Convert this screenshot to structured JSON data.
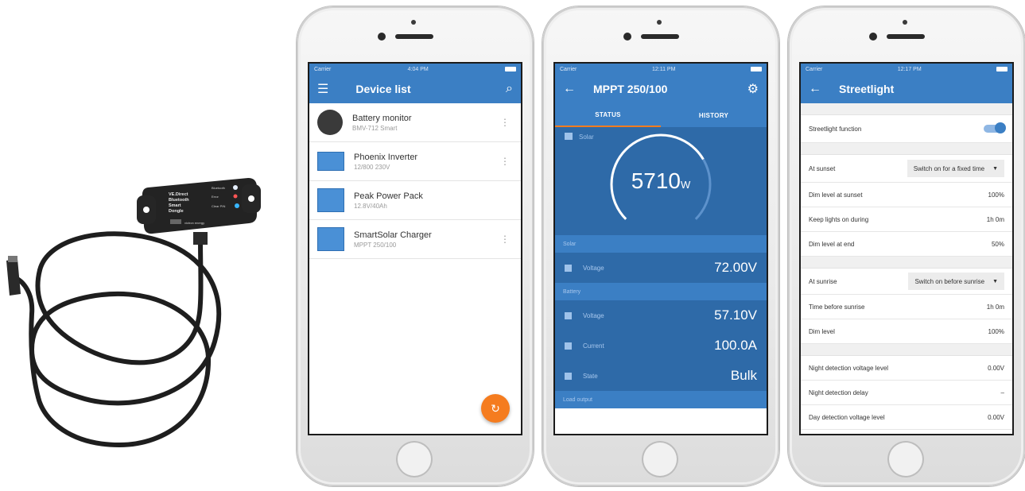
{
  "dongle": {
    "label_lines": [
      "VE.Direct",
      "Bluetooth",
      "Smart",
      "Dongle"
    ],
    "led_labels": [
      "Bluetooth",
      "Error",
      "Clear PIN"
    ],
    "brand": "victron energy"
  },
  "phone1": {
    "status": {
      "carrier": "Carrier",
      "time": "4:04 PM"
    },
    "appbar": {
      "title": "Device list",
      "menu_icon": "menu-icon",
      "search_icon": "search-icon"
    },
    "devices": [
      {
        "name": "Battery monitor",
        "sub": "BMV-712 Smart"
      },
      {
        "name": "Phoenix Inverter",
        "sub": "12/800 230V"
      },
      {
        "name": "Peak Power Pack",
        "sub": "12.8V/40Ah"
      },
      {
        "name": "SmartSolar Charger",
        "sub": "MPPT 250/100"
      }
    ],
    "fab_icon": "refresh-icon"
  },
  "phone2": {
    "status": {
      "carrier": "Carrier",
      "time": "12:11 PM"
    },
    "appbar": {
      "title": "MPPT 250/100",
      "back_icon": "back-arrow-icon",
      "settings_icon": "gear-icon"
    },
    "tabs": [
      "STATUS",
      "HISTORY"
    ],
    "solar": {
      "label": "Solar",
      "power_value": "5710",
      "power_unit": "W",
      "gauge_fraction": 0.72
    },
    "sections": [
      {
        "header": "Solar",
        "rows": [
          {
            "label": "Voltage",
            "value": "72.00V"
          }
        ]
      },
      {
        "header": "Battery",
        "rows": [
          {
            "label": "Voltage",
            "value": "57.10V"
          },
          {
            "label": "Current",
            "value": "100.0A"
          },
          {
            "label": "State",
            "value": "Bulk"
          }
        ]
      },
      {
        "header": "Load output",
        "rows": []
      }
    ]
  },
  "phone3": {
    "status": {
      "carrier": "Carrier",
      "time": "12:17 PM"
    },
    "appbar": {
      "title": "Streetlight",
      "back_icon": "back-arrow-icon"
    },
    "function_row": {
      "label": "Streetlight function",
      "on": true
    },
    "sunset_group": [
      {
        "label": "At sunset",
        "value": "Switch on for a fixed time",
        "select": true
      },
      {
        "label": "Dim level at sunset",
        "value": "100%"
      },
      {
        "label": "Keep lights on during",
        "value": "1h 0m"
      },
      {
        "label": "Dim level at end",
        "value": "50%"
      }
    ],
    "sunrise_group": [
      {
        "label": "At sunrise",
        "value": "Switch on before sunrise",
        "select": true
      },
      {
        "label": "Time before sunrise",
        "value": "1h 0m"
      },
      {
        "label": "Dim level",
        "value": "100%"
      }
    ],
    "detection_group": [
      {
        "label": "Night detection voltage level",
        "value": "0.00V"
      },
      {
        "label": "Night detection delay",
        "value": "–"
      },
      {
        "label": "Day detection voltage level",
        "value": "0.00V"
      }
    ]
  },
  "colors": {
    "primary": "#3b7fc4",
    "primary_dark": "#2e6aa8",
    "accent": "#f57c1f"
  }
}
